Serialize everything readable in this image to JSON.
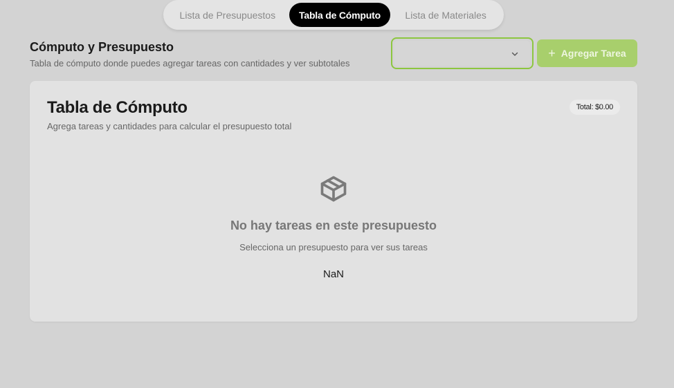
{
  "tabs": [
    {
      "label": "Lista de Presupuestos",
      "active": false
    },
    {
      "label": "Tabla de Cómputo",
      "active": true
    },
    {
      "label": "Lista de Materiales",
      "active": false
    }
  ],
  "header": {
    "title": "Cómputo y Presupuesto",
    "subtitle": "Tabla de cómputo donde puedes agregar tareas con cantidades y ver subtotales"
  },
  "budget_select": {
    "value": "",
    "icon": "chevron-down-icon"
  },
  "add_task_button": {
    "icon": "plus-icon",
    "label": "Agregar Tarea"
  },
  "card": {
    "title": "Tabla de Cómputo",
    "subtitle": "Agrega tareas y cantidades para calcular el presupuesto total",
    "total_badge": "Total: $0.00",
    "empty_state": {
      "icon": "package-icon",
      "title": "No hay tareas en este presupuesto",
      "subtitle": "Selecciona un presupuesto para ver sus tareas",
      "value": "NaN"
    }
  },
  "colors": {
    "background": "#d3d3d3",
    "accent": "#8cc63f",
    "button": "#a8cf6c",
    "active_tab": "#000000"
  }
}
